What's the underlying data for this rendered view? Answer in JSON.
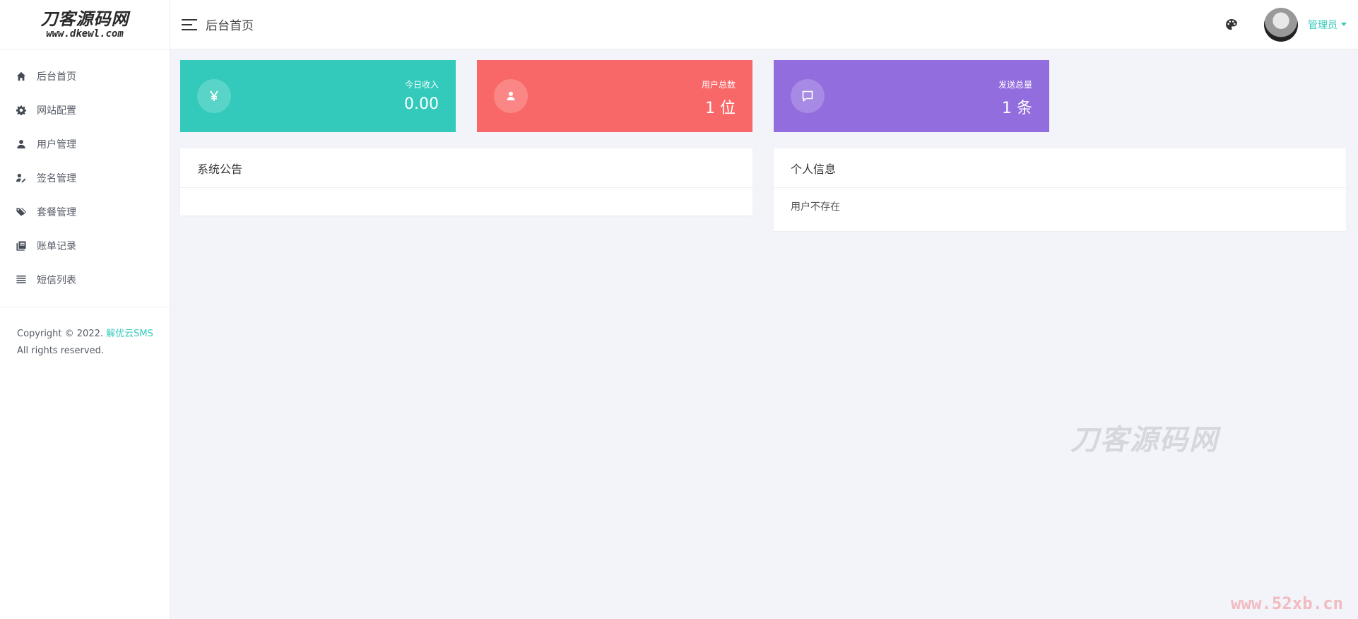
{
  "logo": {
    "main": "刀客源码网",
    "sub": "www.dkewl.com"
  },
  "sidebar": {
    "items": [
      {
        "label": "后台首页",
        "icon": "home-icon"
      },
      {
        "label": "网站配置",
        "icon": "gear-icon"
      },
      {
        "label": "用户管理",
        "icon": "user-icon"
      },
      {
        "label": "签名管理",
        "icon": "signature-icon"
      },
      {
        "label": "套餐管理",
        "icon": "tags-icon"
      },
      {
        "label": "账单记录",
        "icon": "book-icon"
      },
      {
        "label": "短信列表",
        "icon": "list-icon"
      }
    ],
    "copyright_prefix": "Copyright © 2022.",
    "copyright_brand": "解优云SMS",
    "copyright_suffix": "All rights reserved."
  },
  "header": {
    "title": "后台首页",
    "user_name": "管理员",
    "theme_icon": "palette-icon"
  },
  "stats": [
    {
      "label": "今日收入",
      "value": "0.00",
      "icon": "yen-icon",
      "color": "#33cabb"
    },
    {
      "label": "用户总数",
      "value": "1 位",
      "icon": "user-icon",
      "color": "#f96868"
    },
    {
      "label": "发送总量",
      "value": "1 条",
      "icon": "message-icon",
      "color": "#926dde"
    }
  ],
  "panels": {
    "notice": {
      "title": "系统公告",
      "body": ""
    },
    "profile": {
      "title": "个人信息",
      "body": "用户不存在"
    }
  },
  "watermark": {
    "main": "刀客源码网",
    "corner": "www.52xb.cn"
  },
  "colors": {
    "accent": "#33cabb",
    "red": "#f96868",
    "purple": "#926dde",
    "bg": "#f3f4f9"
  }
}
